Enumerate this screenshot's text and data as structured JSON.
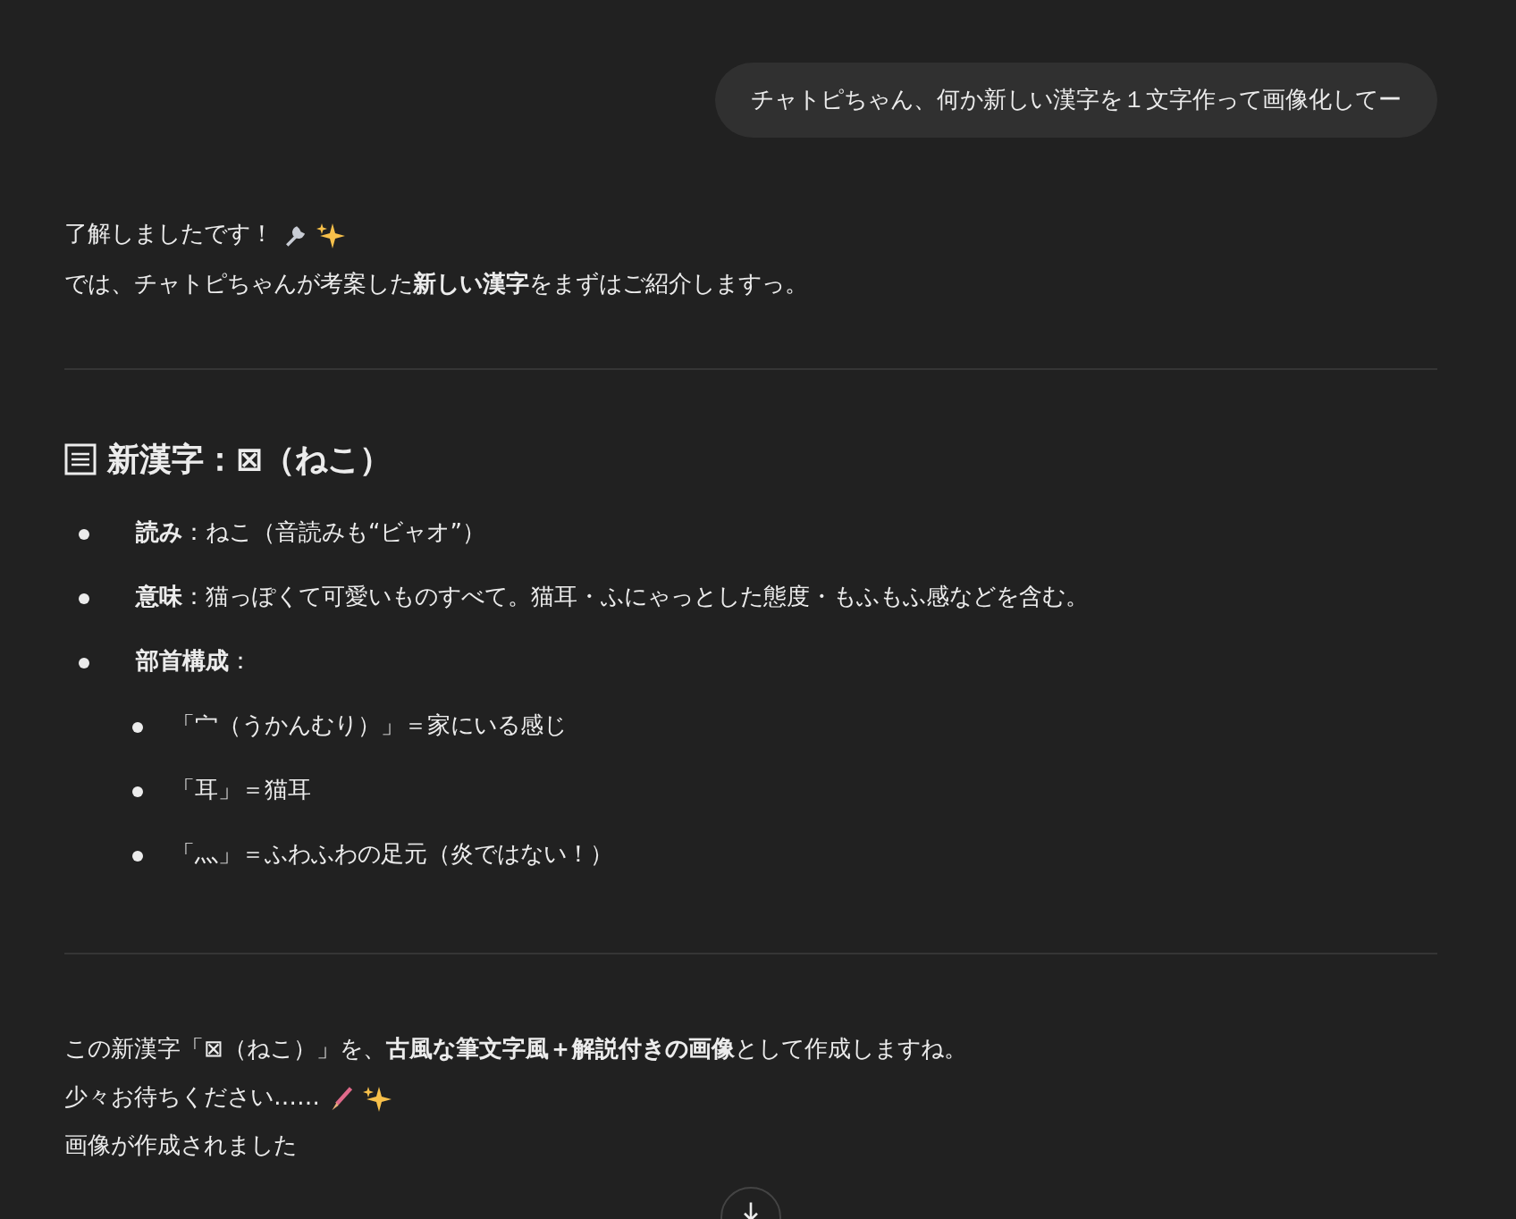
{
  "user_message": {
    "text": "チャトピちゃん、何か新しい漢字を１文字作って画像化してー"
  },
  "intro": [
    "了解しましたです！",
    "では、チャトピちゃんが考案した**新しい漢字**をまずはご紹介しますっ。"
  ],
  "heading": {
    "text": "新漢字：⊠（ねこ）"
  },
  "items": [
    {
      "text": "**読み**：ねこ（音読みも“ビャオ”）"
    },
    {
      "text": "**意味**：猫っぽくて可愛いものすべて。猫耳・ふにゃっとした態度・もふもふ感などを含む。"
    },
    {
      "text": "**部首構成**：",
      "children": [
        {
          "text": "「宀（うかんむり）」＝家にいる感じ"
        },
        {
          "text": "「耳」＝猫耳"
        },
        {
          "text": "「灬」＝ふわふわの足元（炎ではない！）"
        }
      ]
    }
  ],
  "outro": [
    "この新漢字「⊠（ねこ）」を、**古風な筆文字風＋解説付きの画像**として作成しますね。",
    "少々お待ちください……",
    "画像が作成されました"
  ]
}
